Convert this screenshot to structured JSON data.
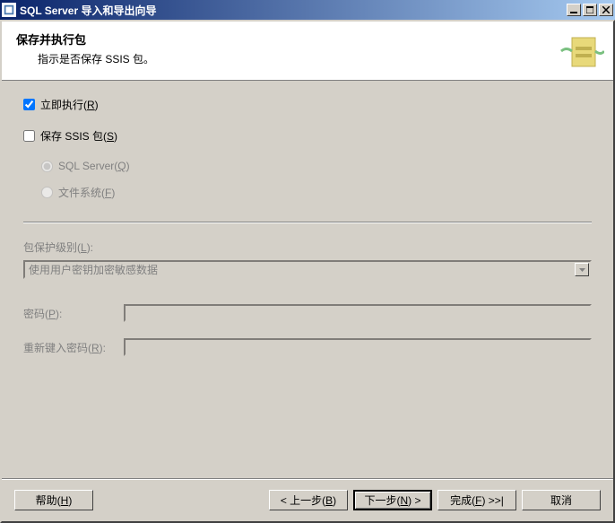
{
  "titlebar": {
    "title": "SQL Server 导入和导出向导"
  },
  "header": {
    "title": "保存并执行包",
    "subtitle": "指示是否保存 SSIS 包。"
  },
  "checkboxes": {
    "run_now": "立即执行(R)",
    "save_ssis": "保存 SSIS 包(S)"
  },
  "radios": {
    "sql_server": "SQL Server(Q)",
    "file_system": "文件系统(F)"
  },
  "protection": {
    "label": "包保护级别(L):",
    "value": "使用用户密钥加密敏感数据"
  },
  "password": {
    "label": "密码(P):",
    "retype_label": "重新键入密码(R):"
  },
  "buttons": {
    "help": "帮助(H)",
    "back": "< 上一步(B)",
    "next": "下一步(N) >",
    "finish": "完成(F) >>|",
    "cancel": "取消"
  }
}
